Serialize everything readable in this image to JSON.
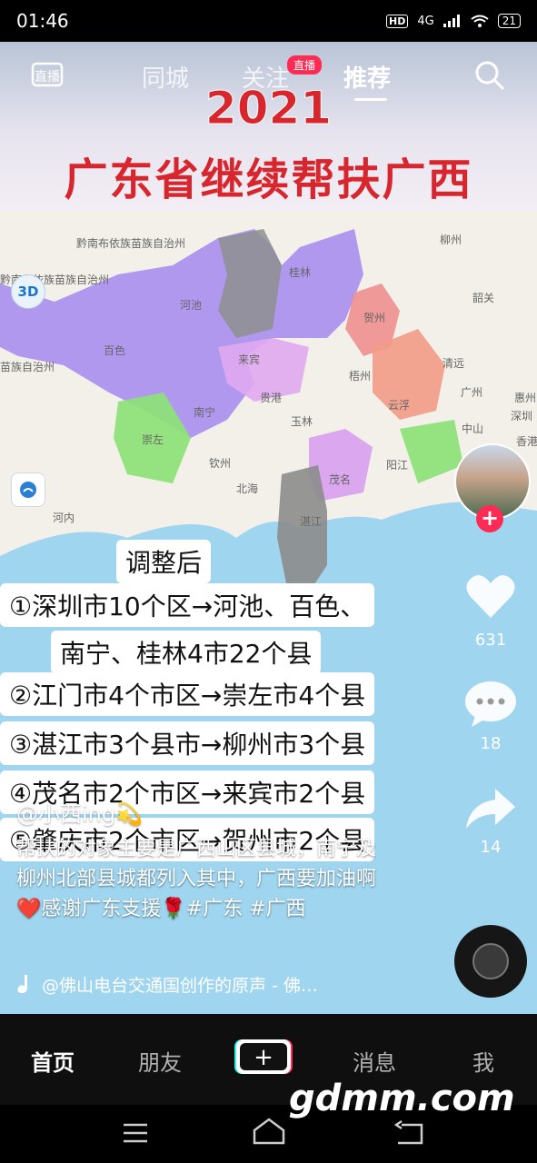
{
  "status_bar": {
    "time": "01:46",
    "hd": "HD",
    "network": "4G",
    "battery": "21"
  },
  "top_nav": {
    "live": "直播",
    "tabs": [
      "同城",
      "关注",
      "推荐"
    ],
    "live_badge": "直播",
    "active": "推荐"
  },
  "video": {
    "banner_year": "2021",
    "banner_title": "广东省继续帮扶广西",
    "map_badge": "3D",
    "map_labels": [
      "黔南布依族苗族自治州",
      "黔南布依族苗族自治州",
      "柳州",
      "桂林",
      "河池",
      "贺州",
      "韶关",
      "百色",
      "来宾",
      "梧州",
      "清远",
      "广州",
      "惠州",
      "南宁",
      "贵港",
      "玉林",
      "云浮",
      "中山",
      "深圳",
      "香港",
      "崇左",
      "钦州",
      "北海",
      "湛江",
      "茂名",
      "阳江",
      "河内",
      "苗族自治州"
    ],
    "overlay_title": "调整后",
    "overlay_lines": [
      "①深圳市10个区→河池、百色、",
      "南宁、桂林4市22个县",
      "②江门市4个市区→崇左市4个县",
      "③湛江市3个县市→柳州市3个县",
      "④茂名市2个市区→来宾市2个县",
      "⑤肇庆市2个市区→贺州市2个县"
    ]
  },
  "actions": {
    "likes": "631",
    "comments": "18",
    "shares": "14"
  },
  "post": {
    "author": "@小西ing💫",
    "description": "帮扶的对象主要是广西山区县城，南宁及柳州北部县城都列入其中，广西要加油啊❤️感谢广东支援🌹#广东 #广西",
    "music": "@佛山电台交通国创作的原声 - 佛…"
  },
  "bottom_tabs": {
    "home": "首页",
    "friends": "朋友",
    "messages": "消息",
    "me": "我",
    "create": "+"
  },
  "watermark": "gdmm.com",
  "colors": {
    "accent": "#fe2c55",
    "title_red": "#d8262e"
  }
}
